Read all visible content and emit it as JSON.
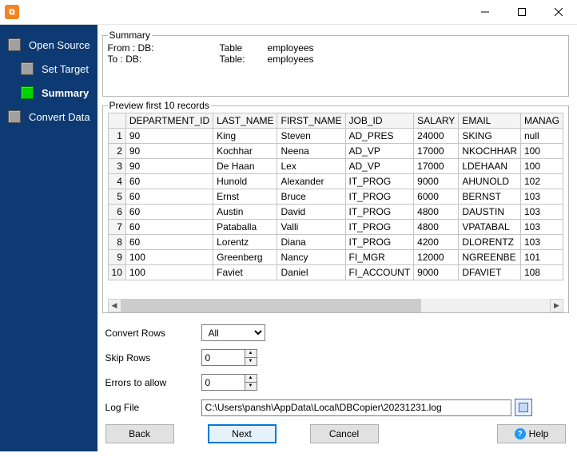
{
  "sidebar": {
    "steps": [
      {
        "label": "Open Source"
      },
      {
        "label": "Set Target"
      },
      {
        "label": "Summary"
      },
      {
        "label": "Convert Data"
      }
    ]
  },
  "summary": {
    "legend": "Summary",
    "from_label": "From : DB:",
    "to_label": "To : DB:",
    "table_word": "Table",
    "table_word_colon": "Table:",
    "table_name": "employees"
  },
  "preview": {
    "legend": "Preview first 10 records",
    "columns": [
      "DEPARTMENT_ID",
      "LAST_NAME",
      "FIRST_NAME",
      "JOB_ID",
      "SALARY",
      "EMAIL",
      "MANAG"
    ],
    "rows": [
      [
        "90",
        "King",
        "Steven",
        "AD_PRES",
        "24000",
        "SKING",
        "null"
      ],
      [
        "90",
        "Kochhar",
        "Neena",
        "AD_VP",
        "17000",
        "NKOCHHAR",
        "100"
      ],
      [
        "90",
        "De Haan",
        "Lex",
        "AD_VP",
        "17000",
        "LDEHAAN",
        "100"
      ],
      [
        "60",
        "Hunold",
        "Alexander",
        "IT_PROG",
        "9000",
        "AHUNOLD",
        "102"
      ],
      [
        "60",
        "Ernst",
        "Bruce",
        "IT_PROG",
        "6000",
        "BERNST",
        "103"
      ],
      [
        "60",
        "Austin",
        "David",
        "IT_PROG",
        "4800",
        "DAUSTIN",
        "103"
      ],
      [
        "60",
        "Pataballa",
        "Valli",
        "IT_PROG",
        "4800",
        "VPATABAL",
        "103"
      ],
      [
        "60",
        "Lorentz",
        "Diana",
        "IT_PROG",
        "4200",
        "DLORENTZ",
        "103"
      ],
      [
        "100",
        "Greenberg",
        "Nancy",
        "FI_MGR",
        "12000",
        "NGREENBE",
        "101"
      ],
      [
        "100",
        "Faviet",
        "Daniel",
        "FI_ACCOUNT",
        "9000",
        "DFAVIET",
        "108"
      ]
    ]
  },
  "form": {
    "convert_rows_label": "Convert Rows",
    "convert_rows_value": "All",
    "skip_rows_label": "Skip Rows",
    "skip_rows_value": "0",
    "errors_label": "Errors to allow",
    "errors_value": "0",
    "logfile_label": "Log File",
    "logfile_value": "C:\\Users\\pansh\\AppData\\Local\\DBCopier\\20231231.log"
  },
  "buttons": {
    "back": "Back",
    "next": "Next",
    "cancel": "Cancel",
    "help": "Help"
  }
}
